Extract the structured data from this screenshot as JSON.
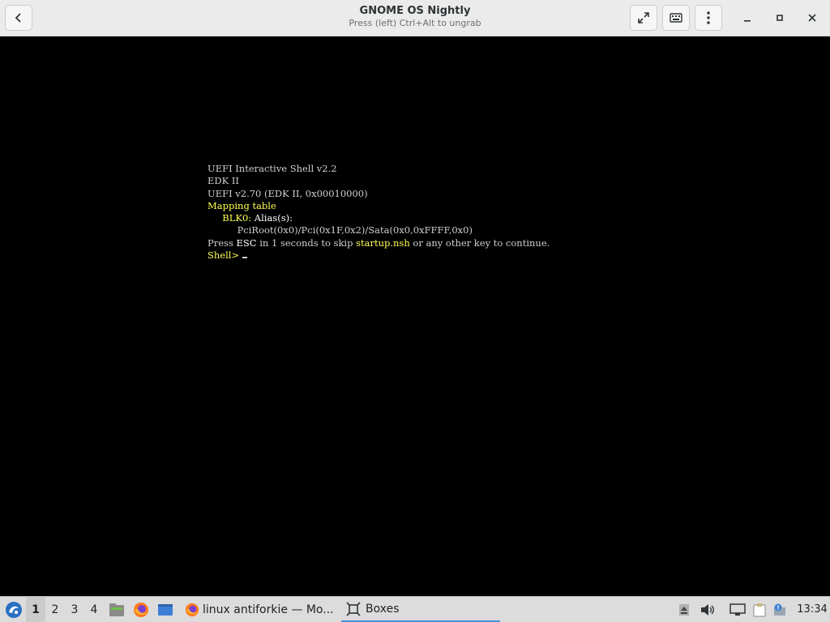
{
  "header": {
    "title": "GNOME OS Nightly",
    "subtitle": "Press (left) Ctrl+Alt to ungrab"
  },
  "console": {
    "line1": "UEFI Interactive Shell v2.2",
    "line2": "EDK II",
    "line3": "UEFI v2.70 (EDK II, 0x00010000)",
    "line4": "Mapping table",
    "line5_device": "BLK0:",
    "line5_rest": " Alias(s):",
    "line6": "PciRoot(0x0)/Pci(0x1F,0x2)/Sata(0x0,0xFFFF,0x0)",
    "line7_a": "Press ",
    "line7_esc": "ESC",
    "line7_b": " in 1 seconds to skip ",
    "line7_file": "startup.nsh",
    "line7_c": " or any other key to continue.",
    "prompt": "Shell>"
  },
  "taskbar": {
    "workspaces": [
      "1",
      "2",
      "3",
      "4"
    ],
    "tasks": [
      {
        "label": "linux antiforkie — Mo..."
      },
      {
        "label": "Boxes"
      }
    ],
    "clock": "13:34"
  },
  "colors": {
    "console_bg": "#000000",
    "console_text": "#cfcfcf",
    "console_highlight": "#ffff55",
    "accent": "#4a90d9"
  }
}
